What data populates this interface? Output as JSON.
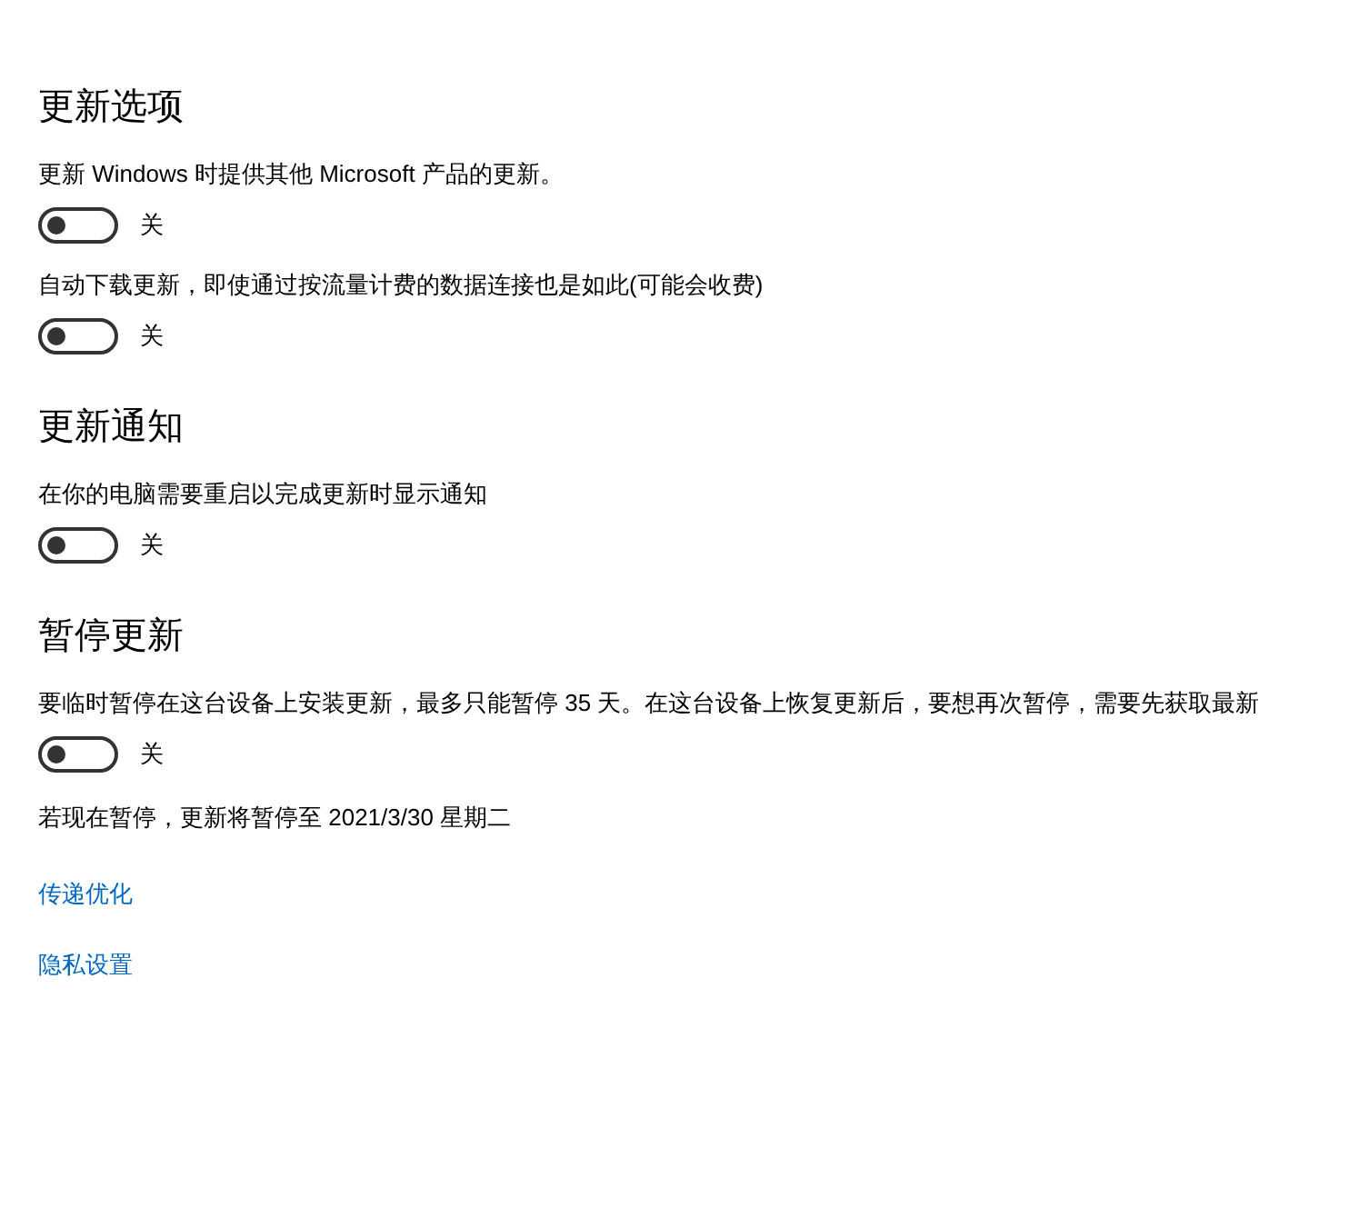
{
  "sections": [
    {
      "heading": "更新选项",
      "items": [
        {
          "kind": "toggle",
          "label": "更新 Windows 时提供其他 Microsoft 产品的更新。",
          "on": false,
          "state_text": "关"
        },
        {
          "kind": "toggle",
          "label": "自动下载更新，即使通过按流量计费的数据连接也是如此(可能会收费)",
          "on": false,
          "state_text": "关"
        }
      ]
    },
    {
      "heading": "更新通知",
      "items": [
        {
          "kind": "toggle",
          "label": "在你的电脑需要重启以完成更新时显示通知",
          "on": false,
          "state_text": "关"
        }
      ]
    },
    {
      "heading": "暂停更新",
      "items": [
        {
          "kind": "toggle",
          "label": "要临时暂停在这台设备上安装更新，最多只能暂停 35 天。在这台设备上恢复更新后，要想再次暂停，需要先获取最新",
          "on": false,
          "state_text": "关"
        },
        {
          "kind": "note",
          "text": "若现在暂停，更新将暂停至 2021/3/30 星期二"
        }
      ]
    }
  ],
  "links": [
    "传递优化",
    "隐私设置"
  ]
}
